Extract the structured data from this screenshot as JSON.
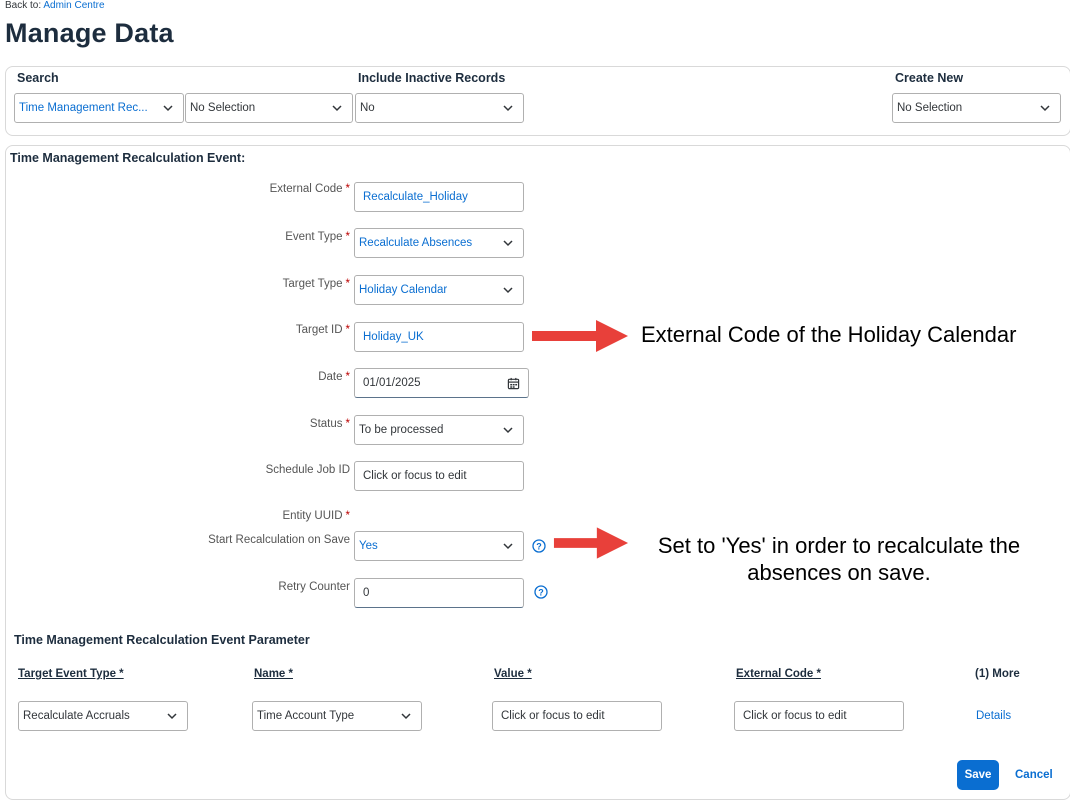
{
  "nav": {
    "back_prefix": "Back to:",
    "back_link": "Admin Centre"
  },
  "page": {
    "title": "Manage Data"
  },
  "search": {
    "label": "Search",
    "object_type": "Time Management Rec...",
    "object_select": "No Selection",
    "inactive_label": "Include Inactive Records",
    "inactive_value": "No",
    "create_label": "Create New",
    "create_value": "No Selection"
  },
  "form": {
    "title": "Time Management Recalculation Event:",
    "required_mark": "*",
    "fields": {
      "external_code": {
        "label": "External Code",
        "value": "Recalculate_Holiday"
      },
      "event_type": {
        "label": "Event Type",
        "value": "Recalculate Absences"
      },
      "target_type": {
        "label": "Target Type",
        "value": "Holiday Calendar"
      },
      "target_id": {
        "label": "Target ID",
        "value": "Holiday_UK"
      },
      "date": {
        "label": "Date",
        "value": "01/01/2025"
      },
      "status": {
        "label": "Status",
        "value": "To be processed"
      },
      "schedule_job_id": {
        "label": "Schedule Job ID",
        "value": "Click or focus to edit"
      },
      "entity_uuid": {
        "label": "Entity UUID"
      },
      "start_recalc": {
        "label": "Start Recalculation on Save",
        "value": "Yes"
      },
      "retry_counter": {
        "label": "Retry Counter",
        "value": "0"
      }
    }
  },
  "params": {
    "title": "Time Management Recalculation Event Parameter",
    "columns": [
      "Target Event Type *",
      "Name *",
      "Value *",
      "External Code *",
      "(1) More"
    ],
    "row": {
      "target_event_type": "Recalculate Accruals",
      "name": "Time Account Type",
      "value": "Click or focus to edit",
      "external_code": "Click or focus to edit",
      "details": "Details"
    }
  },
  "actions": {
    "save": "Save",
    "cancel": "Cancel"
  },
  "annotations": {
    "target_id_note": "External Code of the Holiday Calendar",
    "recalc_note_line1": "Set to 'Yes' in order to recalculate the",
    "recalc_note_line2": "absences on save."
  },
  "colors": {
    "link": "#0a6ed1",
    "required": "#bb0000",
    "arrow": "#e8403a",
    "primary_button": "#0a6ed1"
  },
  "icons": [
    "chevron-down-icon",
    "calendar-icon",
    "help-icon",
    "arrow-icon"
  ]
}
